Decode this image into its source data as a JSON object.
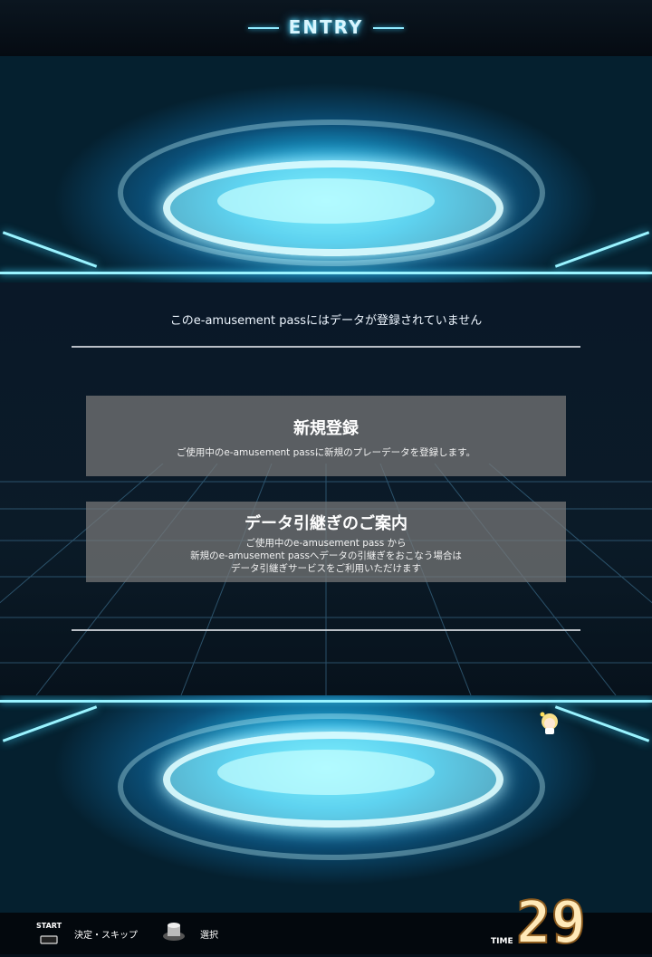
{
  "header": {
    "title": "ENTRY"
  },
  "notice": "このe-amusement passにはデータが登録されていません",
  "options": [
    {
      "title": "新規登録",
      "lines": [
        "ご使用中のe-amusement passに新規のプレーデータを登録します。"
      ]
    },
    {
      "title": "データ引継ぎのご案内",
      "lines": [
        "ご使用中のe-amusement pass から",
        "新規のe-amusement passへデータの引継ぎをおこなう場合は",
        "データ引継ぎサービスをご利用いただけます"
      ]
    }
  ],
  "footer": {
    "start_label": "START",
    "confirm_label": "決定・スキップ",
    "select_label": "選択",
    "time_label": "TIME",
    "time_value": "29"
  },
  "colors": {
    "accent": "#5fe0ff",
    "timer": "#ffe9b8"
  },
  "icons": [
    "start-button-icon",
    "select-knob-icon",
    "chibi-character-icon"
  ]
}
